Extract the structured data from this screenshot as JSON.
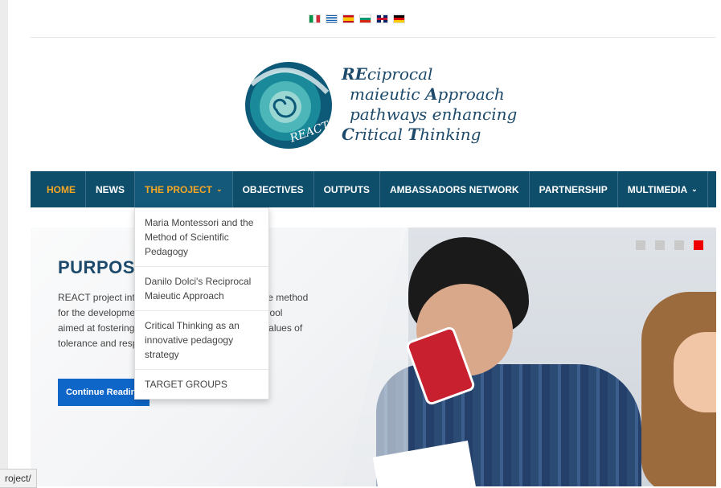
{
  "languages": [
    {
      "code": "it",
      "icon": "italy-flag-icon"
    },
    {
      "code": "gr",
      "icon": "greece-flag-icon"
    },
    {
      "code": "es",
      "icon": "spain-flag-icon"
    },
    {
      "code": "bg",
      "icon": "bulgaria-flag-icon"
    },
    {
      "code": "uk",
      "icon": "uk-flag-icon"
    },
    {
      "code": "de",
      "icon": "germany-flag-icon"
    }
  ],
  "logo": {
    "badge": "REACT",
    "line1_bold": "RE",
    "line1": "ciprocal",
    "line2_pre": "maieutic ",
    "line2_bold": "A",
    "line2": "pproach",
    "line3": "pathways enhancing",
    "line4_bold1": "C",
    "line4_a": "ritical ",
    "line4_bold2": "T",
    "line4_b": "hinking"
  },
  "nav": {
    "home": "HOME",
    "news": "NEWS",
    "project": "THE PROJECT",
    "objectives": "OBJECTIVES",
    "outputs": "OUTPUTS",
    "ambassadors": "AMBASSADORS NETWORK",
    "partnership": "PARTNERSHIP",
    "multimedia": "MULTIMEDIA",
    "chevron": "⌄"
  },
  "dropdown": [
    "Maria Montessori and the Method of Scientific Pedagogy",
    "Danilo Dolci's Reciprocal Maieutic Approach",
    "Critical Thinking as an innovative pedagogy strategy",
    "TARGET GROUPS"
  ],
  "hero": {
    "title": "PURPOSE",
    "text": "REACT project intends to implement an innovative method for the development of critical thinking (CT) in school aimed at fostering inclusive education based on values of tolerance and respect.",
    "cta": "Continue Reading",
    "slides": 4,
    "active_slide": 4
  },
  "status_url": "roject/",
  "colors": {
    "nav_bg": "#0e4e6b",
    "accent": "#f5a623",
    "brand_text": "#1d4a6b",
    "cta": "#0e66c9",
    "active_dot": "#ee0000"
  }
}
